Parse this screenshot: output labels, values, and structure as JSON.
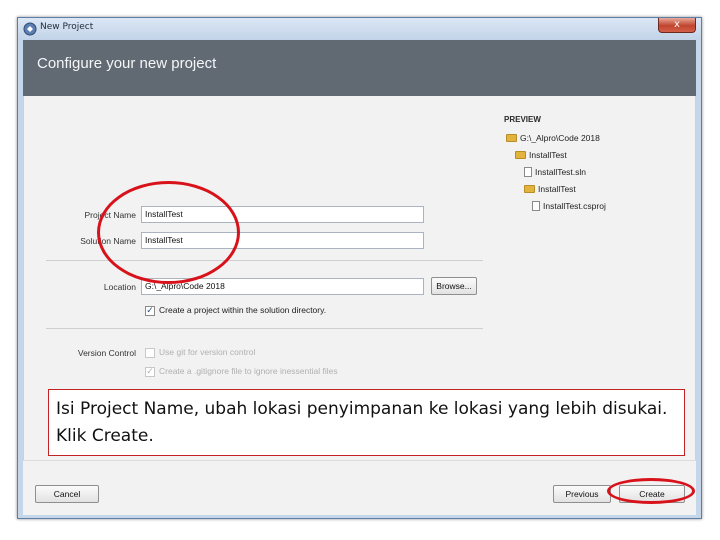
{
  "window": {
    "title": "New Project",
    "close_symbol": "x",
    "icon": "visual-studio-icon"
  },
  "header": {
    "title": "Configure your new project"
  },
  "form": {
    "project_name_label": "Project Name",
    "project_name_value": "InstallTest",
    "solution_name_label": "Solution Name",
    "solution_name_value": "InstallTest",
    "location_label": "Location",
    "location_value": "G:\\_Alpro\\Code 2018",
    "browse_label": "Browse...",
    "create_dir_label": "Create a project within the solution directory.",
    "create_dir_checked": true,
    "version_control_label": "Version Control",
    "use_git_label": "Use git for version control",
    "use_git_checked": false,
    "gitignore_label": "Create a .gitignore file to ignore inessential files",
    "gitignore_checked": true
  },
  "preview": {
    "title": "PREVIEW",
    "items": [
      {
        "label": "G:\\_Alpro\\Code 2018",
        "type": "folder",
        "level": 0
      },
      {
        "label": "InstallTest",
        "type": "folder",
        "level": 1
      },
      {
        "label": "InstallTest.sln",
        "type": "file",
        "level": 2
      },
      {
        "label": "InstallTest",
        "type": "folder",
        "level": 2
      },
      {
        "label": "InstallTest.csproj",
        "type": "file",
        "level": 3
      }
    ]
  },
  "footer": {
    "cancel_label": "Cancel",
    "previous_label": "Previous",
    "create_label": "Create"
  },
  "annotation": {
    "text": "Isi Project Name, ubah lokasi penyimpanan ke lokasi yang lebih disukai. Klik Create."
  },
  "colors": {
    "header_bg": "#616a73",
    "content_bg": "#f2f2f2",
    "annotation_red": "#d8121a",
    "folder": "#e2b43e"
  }
}
